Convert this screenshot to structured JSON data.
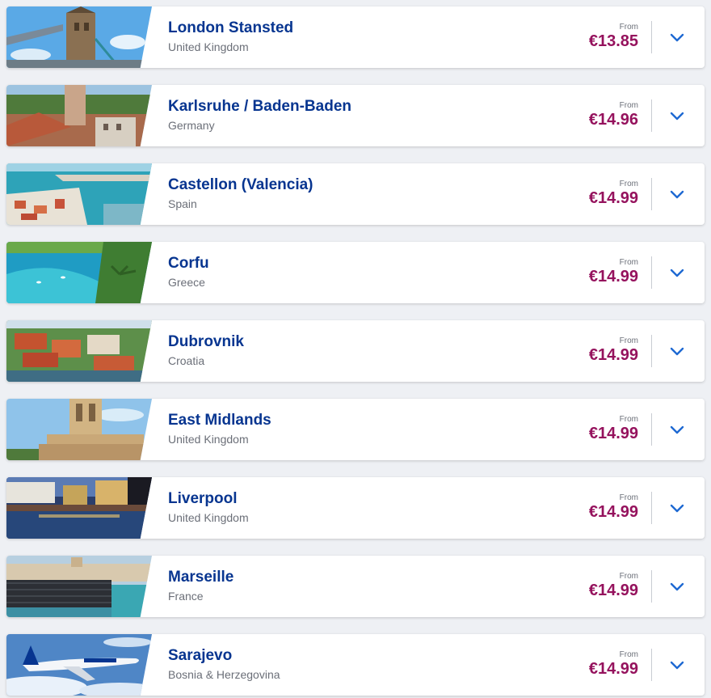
{
  "theme": {
    "city_color": "#073590",
    "price_color": "#95125d",
    "chevron_color": "#1e69d2"
  },
  "destinations": [
    {
      "city": "London Stansted",
      "country": "United Kingdom",
      "from_label": "From",
      "price": "€13.85",
      "image": "london-tower-bridge-photo"
    },
    {
      "city": "Karlsruhe / Baden-Baden",
      "country": "Germany",
      "from_label": "From",
      "price": "€14.96",
      "image": "baden-baden-rooftops-photo"
    },
    {
      "city": "Castellon (Valencia)",
      "country": "Spain",
      "from_label": "From",
      "price": "€14.99",
      "image": "castellon-harbour-photo"
    },
    {
      "city": "Corfu",
      "country": "Greece",
      "from_label": "From",
      "price": "€14.99",
      "image": "corfu-bay-photo"
    },
    {
      "city": "Dubrovnik",
      "country": "Croatia",
      "from_label": "From",
      "price": "€14.99",
      "image": "dubrovnik-old-town-photo"
    },
    {
      "city": "East Midlands",
      "country": "United Kingdom",
      "from_label": "From",
      "price": "€14.99",
      "image": "east-midlands-tower-photo"
    },
    {
      "city": "Liverpool",
      "country": "United Kingdom",
      "from_label": "From",
      "price": "€14.99",
      "image": "liverpool-waterfront-photo"
    },
    {
      "city": "Marseille",
      "country": "France",
      "from_label": "From",
      "price": "€14.99",
      "image": "marseille-harbour-photo"
    },
    {
      "city": "Sarajevo",
      "country": "Bosnia & Herzegovina",
      "from_label": "From",
      "price": "€14.99",
      "image": "ryanair-aircraft-photo"
    }
  ]
}
